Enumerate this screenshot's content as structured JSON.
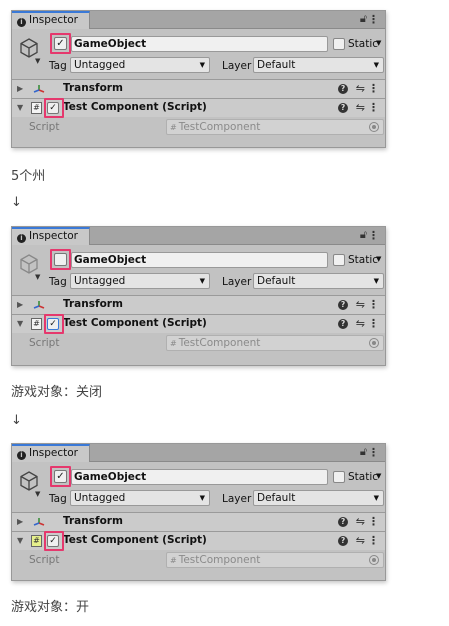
{
  "inspector": {
    "tab_label": "Inspector",
    "object_name": "GameObject",
    "static_label": "Static",
    "tag_label": "Tag",
    "tag_value": "Untagged",
    "layer_label": "Layer",
    "layer_value": "Default",
    "transform_label": "Transform",
    "component_label": "Test Component (Script)",
    "script_label": "Script",
    "script_value": "TestComponent"
  },
  "panels": [
    {
      "object_active": true,
      "component_enabled": true,
      "highlight": "object-and-component-checkbox"
    },
    {
      "object_active": false,
      "component_enabled": true,
      "highlight": "object-and-component-checkbox"
    },
    {
      "object_active": true,
      "component_enabled": true,
      "highlight": "object-and-component-checkbox"
    }
  ],
  "captions": {
    "c0": "5个州",
    "c1": "游戏对象：关闭",
    "c2": "游戏对象：开",
    "arrow": "↓"
  },
  "colors": {
    "highlight": "#e5386d",
    "tab_accent": "#3a79d7",
    "panel_bg": "#c2c2c2"
  },
  "icons": [
    "info-icon",
    "lock-icon",
    "menu-dots-icon",
    "gameobject-cube-icon",
    "transform-axis-icon",
    "script-hash-icon",
    "help-icon",
    "preset-icon",
    "object-picker-icon"
  ]
}
